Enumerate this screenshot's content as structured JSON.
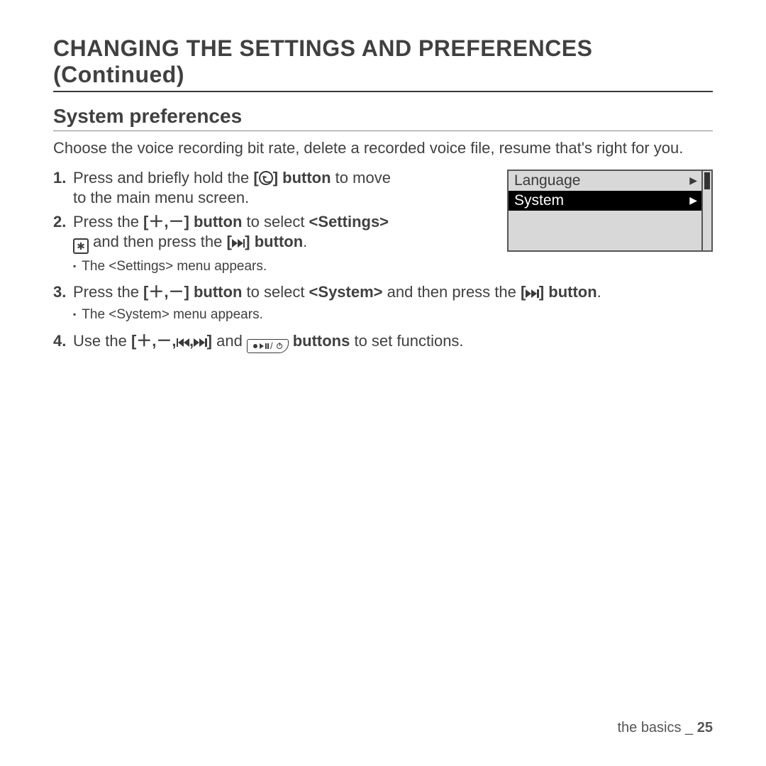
{
  "page_title": "CHANGING THE SETTINGS AND PREFERENCES (Continued)",
  "section_title": "System preferences",
  "intro": "Choose the voice recording bit rate, delete a recorded voice file, resume that's right for you.",
  "steps": {
    "s1": {
      "num": "1.",
      "a": "Press and briefly hold the ",
      "b": " button",
      "c": " to move to the main menu screen."
    },
    "s2": {
      "num": "2.",
      "a": "Press the ",
      "b": " button",
      "c": " to select ",
      "d": "<Settings>",
      "e": " and then press the ",
      "f": " button",
      "g": ".",
      "sub": "The <Settings> menu appears."
    },
    "s3": {
      "num": "3.",
      "a": "Press the ",
      "b": " button",
      "c": " to select ",
      "d": "<System>",
      "e": " and then press the ",
      "f": " button",
      "g": ".",
      "sub": "The <System> menu appears."
    },
    "s4": {
      "num": "4.",
      "a": "Use the ",
      "b": " and ",
      "c": " buttons",
      "d": " to set functions."
    }
  },
  "device": {
    "row1": "Language",
    "row2": "System"
  },
  "footer": {
    "section": "the basics _",
    "page": "25"
  },
  "sym": {
    "open": "[",
    "close": "]",
    "plus": "＋",
    "minus": "－",
    "comma": ",",
    "gear": "✱",
    "tri": "▶"
  }
}
